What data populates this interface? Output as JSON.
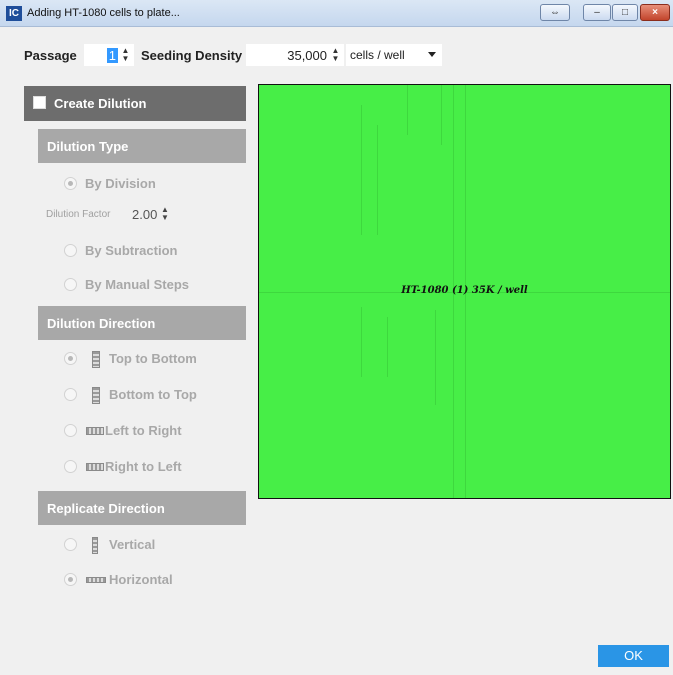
{
  "window": {
    "app_icon": "IC",
    "title": "Adding HT-1080 cells to plate...",
    "buttons": {
      "restore": "⇔",
      "minimize": "–",
      "maximize": "□",
      "close": "×"
    }
  },
  "toolbar": {
    "passage_label": "Passage",
    "passage_value": "1",
    "seeding_label": "Seeding Density",
    "seeding_value": "35,000",
    "unit_value": "cells / well"
  },
  "dilution": {
    "create_label": "Create Dilution",
    "create_checked": false,
    "type_header": "Dilution Type",
    "by_division": "By Division",
    "factor_label": "Dilution Factor",
    "factor_value": "2.00",
    "by_subtraction": "By Subtraction",
    "by_manual": "By Manual Steps",
    "direction_header": "Dilution Direction",
    "top_to_bottom": "Top to Bottom",
    "bottom_to_top": "Bottom to Top",
    "left_to_right": "Left to Right",
    "right_to_left": "Right to Left",
    "replicate_header": "Replicate Direction",
    "vertical": "Vertical",
    "horizontal": "Horizontal"
  },
  "plate": {
    "label": "HT-1080 (1) 35K / well",
    "color": "#47ee47"
  },
  "footer": {
    "ok_label": "OK"
  }
}
